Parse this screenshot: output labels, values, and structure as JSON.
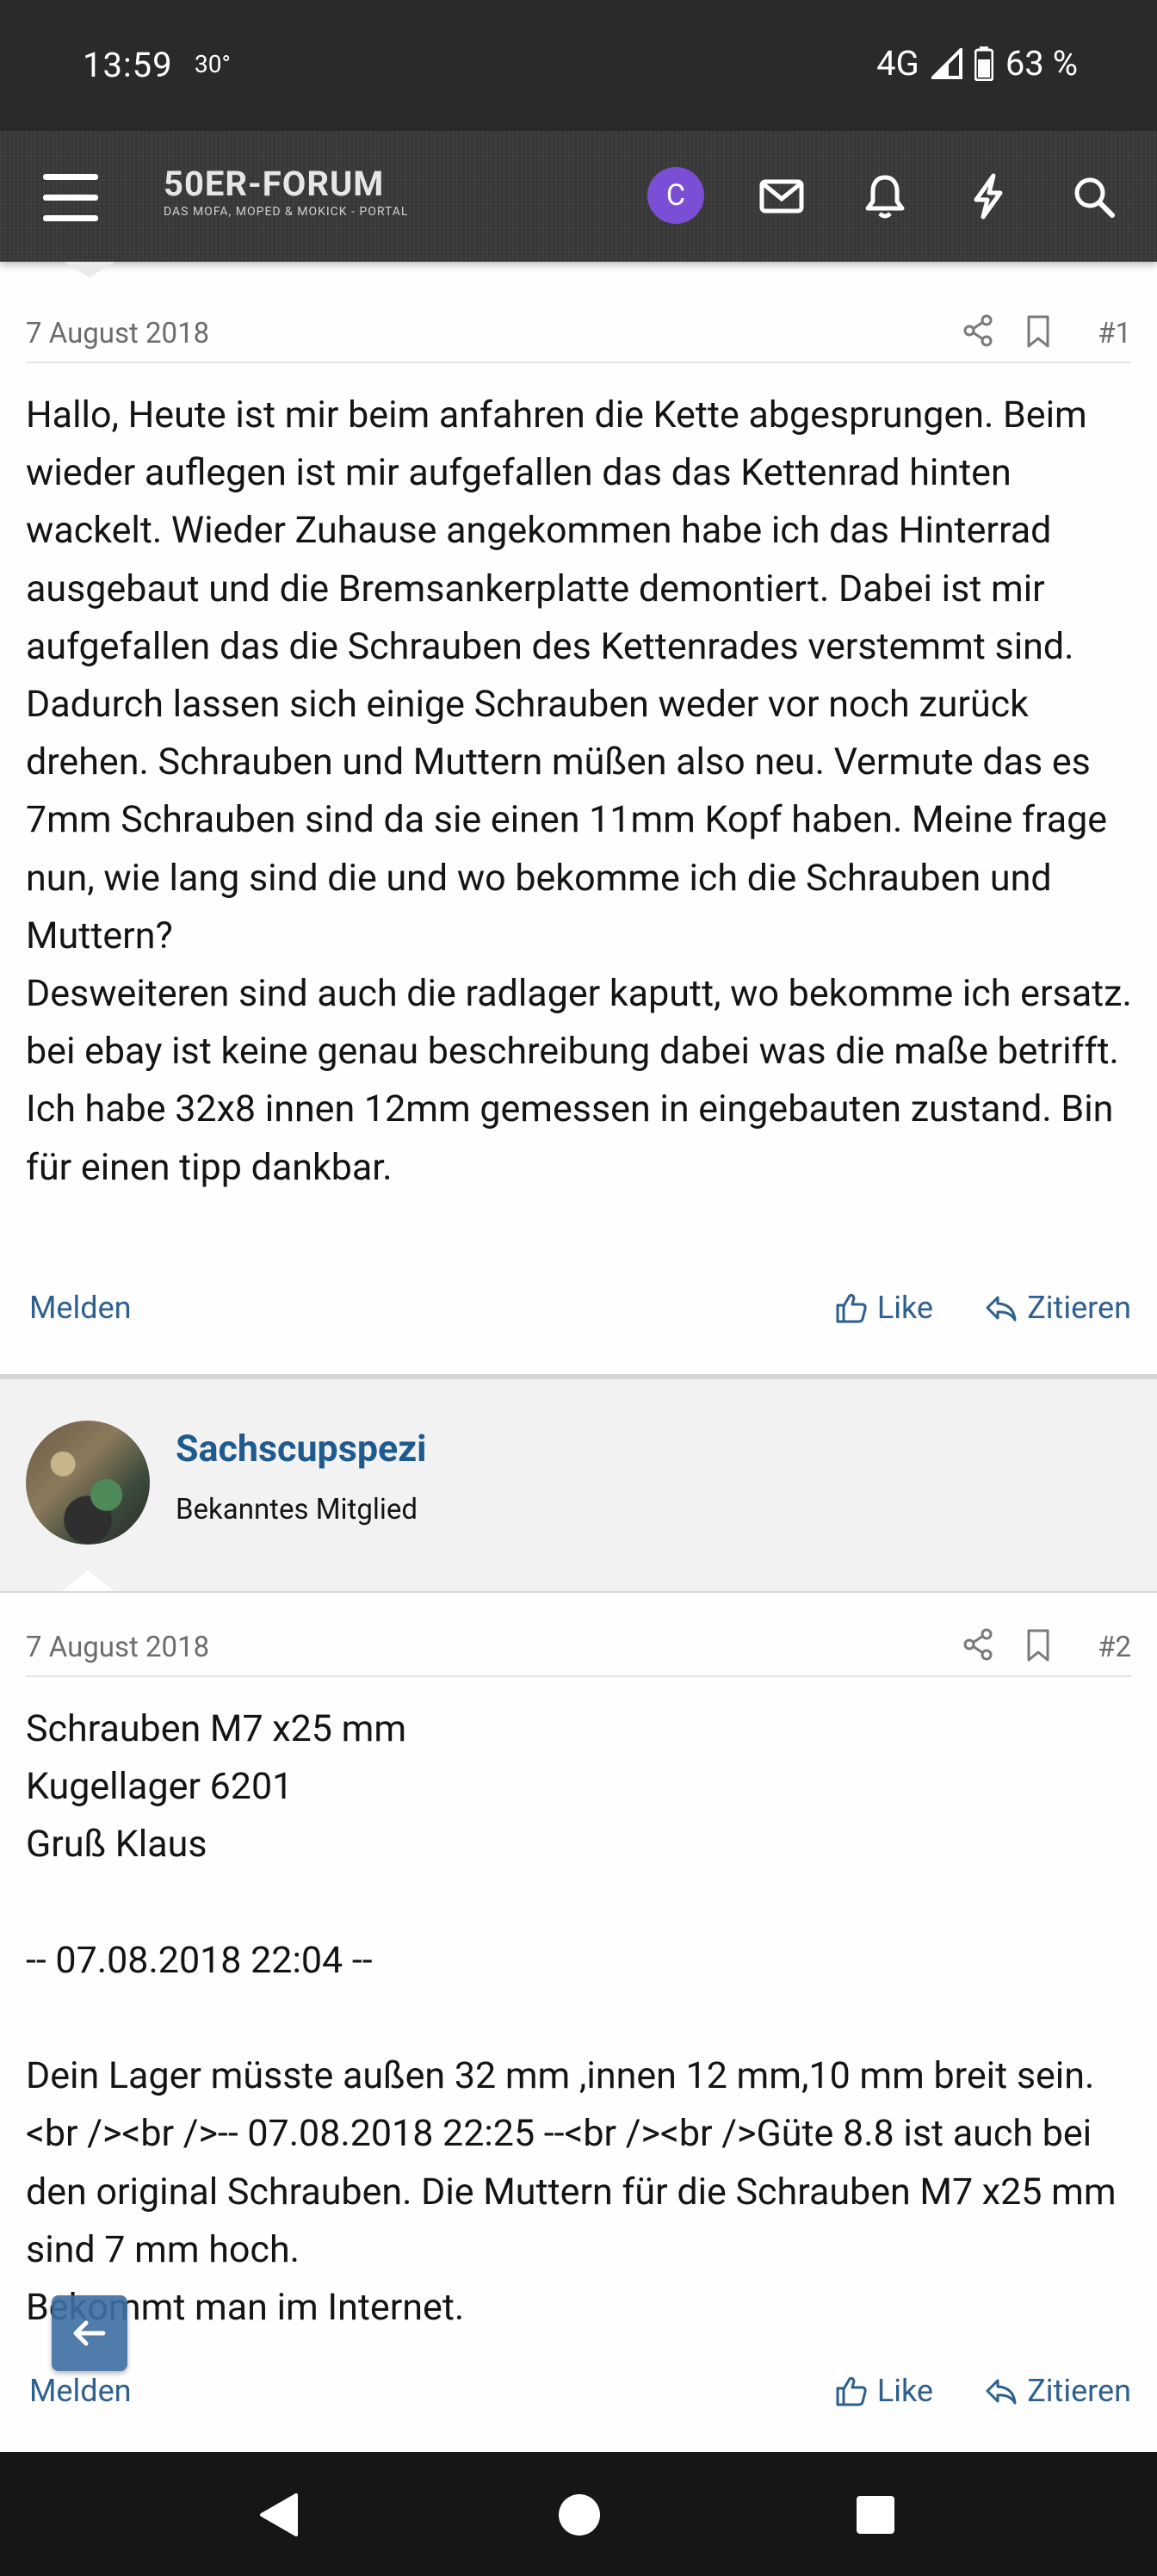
{
  "status_bar": {
    "time": "13:59",
    "temperature": "30°",
    "network": "4G",
    "battery": "63 %"
  },
  "header": {
    "logo_main": "50ER-FORUM",
    "logo_sub": "DAS MOFA, MOPED & MOKICK - PORTAL",
    "account_initial": "C",
    "icons": [
      "menu-icon",
      "envelope-icon",
      "bell-icon",
      "bolt-icon",
      "search-icon"
    ]
  },
  "posts": [
    {
      "date": "7 August 2018",
      "number": "#1",
      "body": "Hallo, Heute ist mir beim anfahren die Kette abgesprungen. Beim wieder auflegen ist mir aufgefallen das das Kettenrad hinten wackelt. Wieder Zuhause angekommen habe ich das Hinterrad ausgebaut und die Bremsankerplatte demontiert. Dabei ist mir aufgefallen das die Schrauben des Kettenrades verstemmt sind.\nDadurch lassen sich einige Schrauben weder vor noch zurück drehen. Schrauben und Muttern müßen also neu. Vermute das es 7mm Schrauben sind da sie einen 11mm Kopf haben. Meine frage nun, wie lang sind die und wo bekomme ich die Schrauben und Muttern?\nDesweiteren sind auch die radlager kaputt, wo bekomme ich ersatz. bei ebay ist keine genau beschreibung dabei was die maße betrifft. Ich habe 32x8 innen 12mm gemessen in eingebauten zustand. Bin für einen tipp dankbar.",
      "report_label": "Melden",
      "like_label": "Like",
      "quote_label": "Zitieren"
    },
    {
      "author": "Sachscupspezi",
      "author_title": "Bekanntes Mitglied",
      "date": "7 August 2018",
      "number": "#2",
      "body": "Schrauben M7 x25 mm\nKugellager 6201\nGruß Klaus\n\n-- 07.08.2018 22:04 --\n\nDein Lager müsste außen 32 mm ,innen 12 mm,10 mm breit sein.<br /><br />-- 07.08.2018 22:25 --<br /><br />Güte 8.8 ist auch bei den original Schrauben. Die Muttern für die Schrauben M7 x25 mm sind 7 mm hoch.\nBekommt man im Internet.",
      "report_label": "Melden",
      "like_label": "Like",
      "quote_label": "Zitieren"
    }
  ],
  "colors": {
    "link": "#2d5f8f",
    "username": "#1f5a8f",
    "avatar_bg": "#7a4fd6",
    "header_bg": "#3a3a3a"
  }
}
